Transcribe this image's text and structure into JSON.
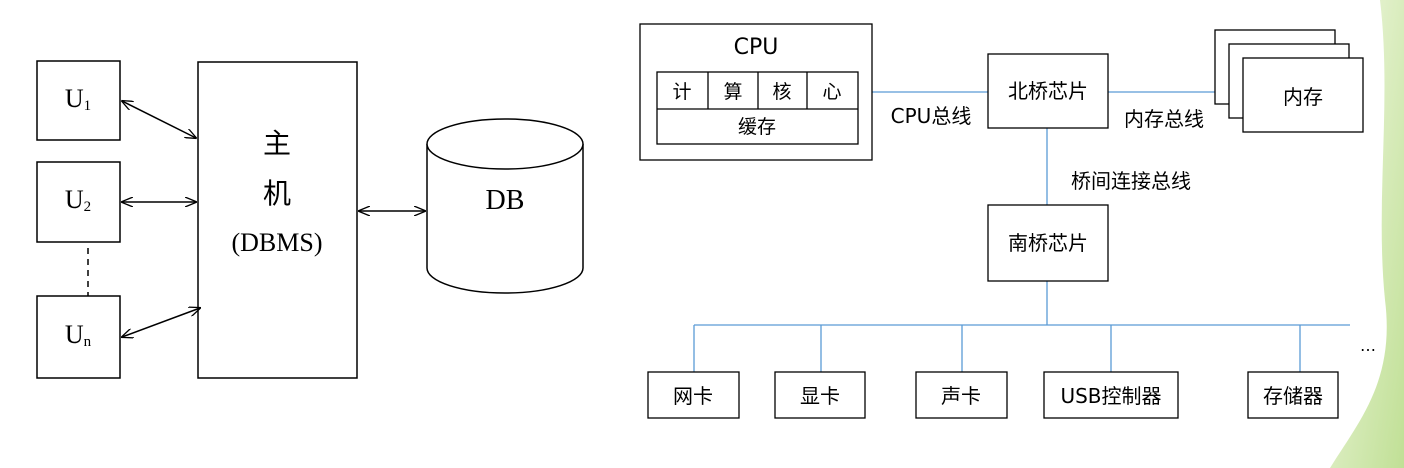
{
  "left_diagram": {
    "users": [
      {
        "main": "U",
        "sub": "1"
      },
      {
        "main": "U",
        "sub": "2"
      },
      {
        "main": "U",
        "sub": "n"
      }
    ],
    "host": {
      "line1": "主",
      "line2": "机",
      "line3": "(DBMS)"
    },
    "database": "DB"
  },
  "right_diagram": {
    "cpu": {
      "title": "CPU",
      "cores": [
        "计",
        "算",
        "核",
        "心"
      ],
      "cache": "缓存"
    },
    "north_bridge": "北桥芯片",
    "memory": "内存",
    "south_bridge": "南桥芯片",
    "buses": {
      "cpu_bus": "CPU总线",
      "memory_bus": "内存总线",
      "bridge_bus": "桥间连接总线"
    },
    "devices": [
      "网卡",
      "显卡",
      "声卡",
      "USB控制器",
      "存储器"
    ],
    "more": "…"
  },
  "colors": {
    "bus_line": "#5b9bd5",
    "stroke": "#000000",
    "decor_green": "#8dc63f"
  }
}
